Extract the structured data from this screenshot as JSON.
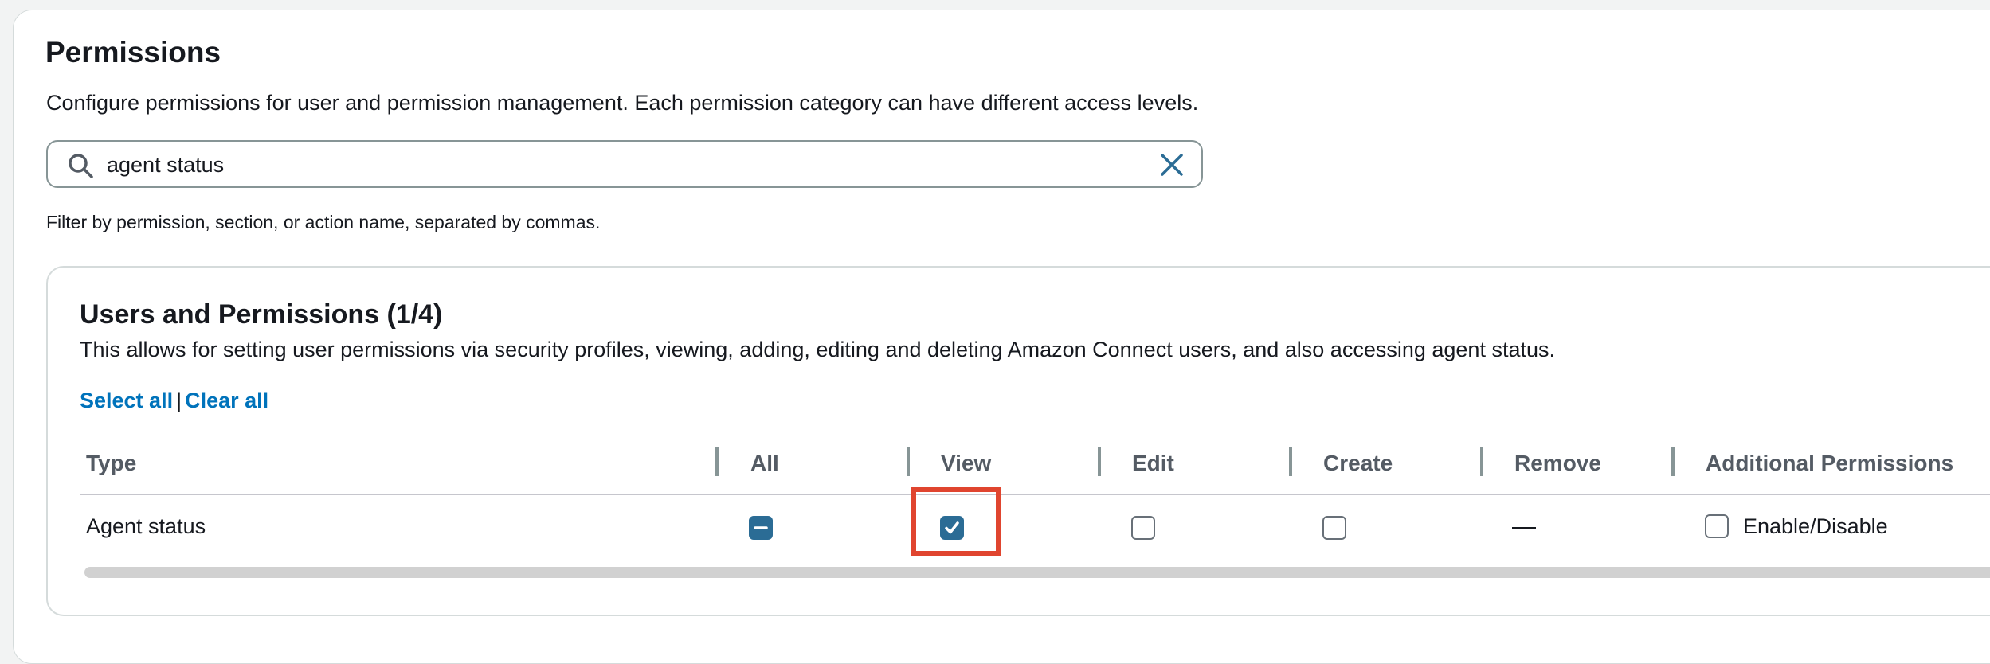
{
  "page": {
    "title": "Permissions",
    "description": "Configure permissions for user and permission management. Each permission category can have different access levels.",
    "search": {
      "value": "agent status",
      "hint": "Filter by permission, section, or action name, separated by commas."
    }
  },
  "section": {
    "title": "Users and Permissions (1/4)",
    "description": "This allows for setting user permissions via security profiles, viewing, adding, editing and deleting Amazon Connect users, and also accessing agent status.",
    "select_all": "Select all",
    "separator": "|",
    "clear_all": "Clear all",
    "columns": [
      "Type",
      "All",
      "View",
      "Edit",
      "Create",
      "Remove",
      "Additional Permissions"
    ],
    "row": {
      "type": "Agent status",
      "all": "indeterminate",
      "view": true,
      "edit": false,
      "create": false,
      "remove": "—",
      "additional_label": "Enable/Disable",
      "additional": false
    }
  },
  "colors": {
    "accent": "#0073bb",
    "checkbox": "#2b6c95",
    "highlight": "#e0452f"
  }
}
